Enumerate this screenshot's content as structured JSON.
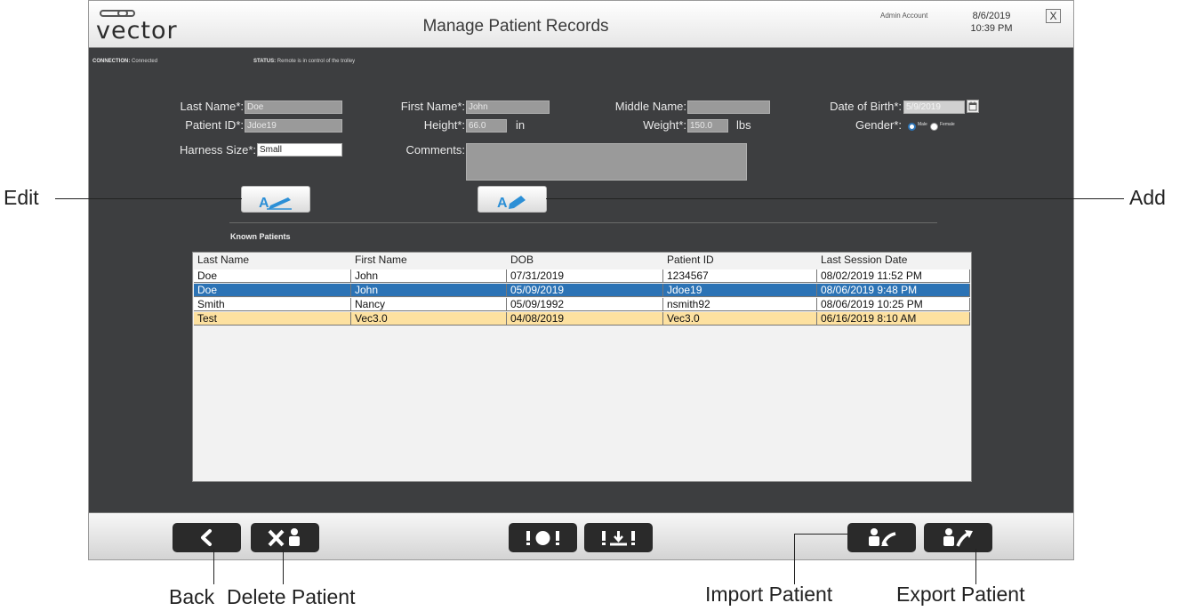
{
  "window": {
    "logo_text": "vector",
    "title": "Manage Patient Records",
    "account": "Admin Account",
    "date": "8/6/2019",
    "time": "10:39 PM",
    "close_label": "X"
  },
  "status_bar": {
    "connection_label": "CONNECTION:",
    "connection_value": "Connected",
    "status_label": "STATUS:",
    "status_value": "Remote is in control of the trolley"
  },
  "form": {
    "last_name_label": "Last Name*:",
    "last_name_value": "Doe",
    "first_name_label": "First Name*:",
    "first_name_value": "John",
    "middle_name_label": "Middle Name:",
    "middle_name_value": "",
    "dob_label": "Date of Birth*:",
    "dob_value": "5/9/2019",
    "patient_id_label": "Patient ID*:",
    "patient_id_value": "Jdoe19",
    "height_label": "Height*:",
    "height_value": "66.0",
    "height_unit": "in",
    "weight_label": "Weight*:",
    "weight_value": "150.0",
    "weight_unit": "lbs",
    "gender_label": "Gender*:",
    "gender_male": "Male",
    "gender_female": "Female",
    "gender_selected": "Male",
    "harness_label": "Harness Size*:",
    "harness_value": "Small",
    "comments_label": "Comments:",
    "comments_value": ""
  },
  "known_patients_label": "Known Patients",
  "table": {
    "columns": [
      "Last Name",
      "First Name",
      "DOB",
      "Patient ID",
      "Last Session Date"
    ],
    "rows": [
      [
        "Doe",
        "John",
        "07/31/2019",
        "1234567",
        "08/02/2019 11:52 PM"
      ],
      [
        "Doe",
        "John",
        "05/09/2019",
        "Jdoe19",
        "08/06/2019 9:48 PM"
      ],
      [
        "Smith",
        "Nancy",
        "05/09/1992",
        "nsmith92",
        "08/06/2019 10:25 PM"
      ],
      [
        "Test",
        "Vec3.0",
        "04/08/2019",
        "Vec3.0",
        "06/16/2019 8:10 AM"
      ]
    ],
    "selected_row": 1,
    "highlighted_row": 3
  },
  "callouts": {
    "edit": "Edit",
    "add": "Add",
    "back": "Back",
    "delete": "Delete Patient",
    "import": "Import Patient",
    "export": "Export Patient"
  },
  "colors": {
    "window_bg": "#3d3e40",
    "selected_row": "#2c73b5",
    "highlighted_row": "#fde1a0",
    "toolbar_button": "#2a2a2a",
    "edit_add_icon": "#2c8fd6"
  },
  "icons": {
    "edit": "pen-icon",
    "add": "pencil-add-icon",
    "back": "chevron-left-icon",
    "delete": "delete-patient-icon",
    "alert": "alert-icon",
    "download": "download-icon",
    "import": "import-patient-icon",
    "export": "export-patient-icon",
    "calendar": "calendar-icon"
  }
}
